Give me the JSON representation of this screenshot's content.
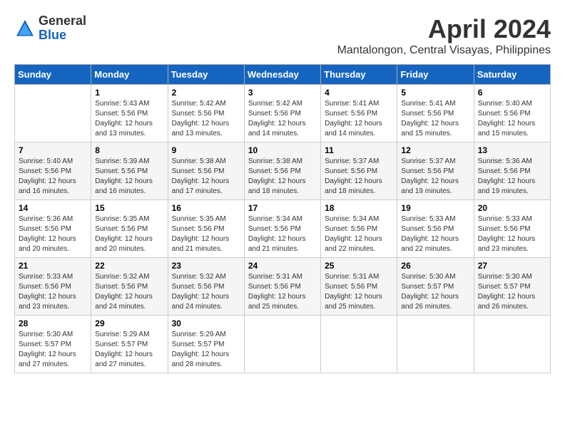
{
  "logo": {
    "general": "General",
    "blue": "Blue"
  },
  "title": "April 2024",
  "location": "Mantalongon, Central Visayas, Philippines",
  "weekdays": [
    "Sunday",
    "Monday",
    "Tuesday",
    "Wednesday",
    "Thursday",
    "Friday",
    "Saturday"
  ],
  "weeks": [
    [
      {
        "day": "",
        "info": ""
      },
      {
        "day": "1",
        "info": "Sunrise: 5:43 AM\nSunset: 5:56 PM\nDaylight: 12 hours\nand 13 minutes."
      },
      {
        "day": "2",
        "info": "Sunrise: 5:42 AM\nSunset: 5:56 PM\nDaylight: 12 hours\nand 13 minutes."
      },
      {
        "day": "3",
        "info": "Sunrise: 5:42 AM\nSunset: 5:56 PM\nDaylight: 12 hours\nand 14 minutes."
      },
      {
        "day": "4",
        "info": "Sunrise: 5:41 AM\nSunset: 5:56 PM\nDaylight: 12 hours\nand 14 minutes."
      },
      {
        "day": "5",
        "info": "Sunrise: 5:41 AM\nSunset: 5:56 PM\nDaylight: 12 hours\nand 15 minutes."
      },
      {
        "day": "6",
        "info": "Sunrise: 5:40 AM\nSunset: 5:56 PM\nDaylight: 12 hours\nand 15 minutes."
      }
    ],
    [
      {
        "day": "7",
        "info": "Sunrise: 5:40 AM\nSunset: 5:56 PM\nDaylight: 12 hours\nand 16 minutes."
      },
      {
        "day": "8",
        "info": "Sunrise: 5:39 AM\nSunset: 5:56 PM\nDaylight: 12 hours\nand 16 minutes."
      },
      {
        "day": "9",
        "info": "Sunrise: 5:38 AM\nSunset: 5:56 PM\nDaylight: 12 hours\nand 17 minutes."
      },
      {
        "day": "10",
        "info": "Sunrise: 5:38 AM\nSunset: 5:56 PM\nDaylight: 12 hours\nand 18 minutes."
      },
      {
        "day": "11",
        "info": "Sunrise: 5:37 AM\nSunset: 5:56 PM\nDaylight: 12 hours\nand 18 minutes."
      },
      {
        "day": "12",
        "info": "Sunrise: 5:37 AM\nSunset: 5:56 PM\nDaylight: 12 hours\nand 19 minutes."
      },
      {
        "day": "13",
        "info": "Sunrise: 5:36 AM\nSunset: 5:56 PM\nDaylight: 12 hours\nand 19 minutes."
      }
    ],
    [
      {
        "day": "14",
        "info": "Sunrise: 5:36 AM\nSunset: 5:56 PM\nDaylight: 12 hours\nand 20 minutes."
      },
      {
        "day": "15",
        "info": "Sunrise: 5:35 AM\nSunset: 5:56 PM\nDaylight: 12 hours\nand 20 minutes."
      },
      {
        "day": "16",
        "info": "Sunrise: 5:35 AM\nSunset: 5:56 PM\nDaylight: 12 hours\nand 21 minutes."
      },
      {
        "day": "17",
        "info": "Sunrise: 5:34 AM\nSunset: 5:56 PM\nDaylight: 12 hours\nand 21 minutes."
      },
      {
        "day": "18",
        "info": "Sunrise: 5:34 AM\nSunset: 5:56 PM\nDaylight: 12 hours\nand 22 minutes."
      },
      {
        "day": "19",
        "info": "Sunrise: 5:33 AM\nSunset: 5:56 PM\nDaylight: 12 hours\nand 22 minutes."
      },
      {
        "day": "20",
        "info": "Sunrise: 5:33 AM\nSunset: 5:56 PM\nDaylight: 12 hours\nand 23 minutes."
      }
    ],
    [
      {
        "day": "21",
        "info": "Sunrise: 5:33 AM\nSunset: 5:56 PM\nDaylight: 12 hours\nand 23 minutes."
      },
      {
        "day": "22",
        "info": "Sunrise: 5:32 AM\nSunset: 5:56 PM\nDaylight: 12 hours\nand 24 minutes."
      },
      {
        "day": "23",
        "info": "Sunrise: 5:32 AM\nSunset: 5:56 PM\nDaylight: 12 hours\nand 24 minutes."
      },
      {
        "day": "24",
        "info": "Sunrise: 5:31 AM\nSunset: 5:56 PM\nDaylight: 12 hours\nand 25 minutes."
      },
      {
        "day": "25",
        "info": "Sunrise: 5:31 AM\nSunset: 5:56 PM\nDaylight: 12 hours\nand 25 minutes."
      },
      {
        "day": "26",
        "info": "Sunrise: 5:30 AM\nSunset: 5:57 PM\nDaylight: 12 hours\nand 26 minutes."
      },
      {
        "day": "27",
        "info": "Sunrise: 5:30 AM\nSunset: 5:57 PM\nDaylight: 12 hours\nand 26 minutes."
      }
    ],
    [
      {
        "day": "28",
        "info": "Sunrise: 5:30 AM\nSunset: 5:57 PM\nDaylight: 12 hours\nand 27 minutes."
      },
      {
        "day": "29",
        "info": "Sunrise: 5:29 AM\nSunset: 5:57 PM\nDaylight: 12 hours\nand 27 minutes."
      },
      {
        "day": "30",
        "info": "Sunrise: 5:29 AM\nSunset: 5:57 PM\nDaylight: 12 hours\nand 28 minutes."
      },
      {
        "day": "",
        "info": ""
      },
      {
        "day": "",
        "info": ""
      },
      {
        "day": "",
        "info": ""
      },
      {
        "day": "",
        "info": ""
      }
    ]
  ]
}
